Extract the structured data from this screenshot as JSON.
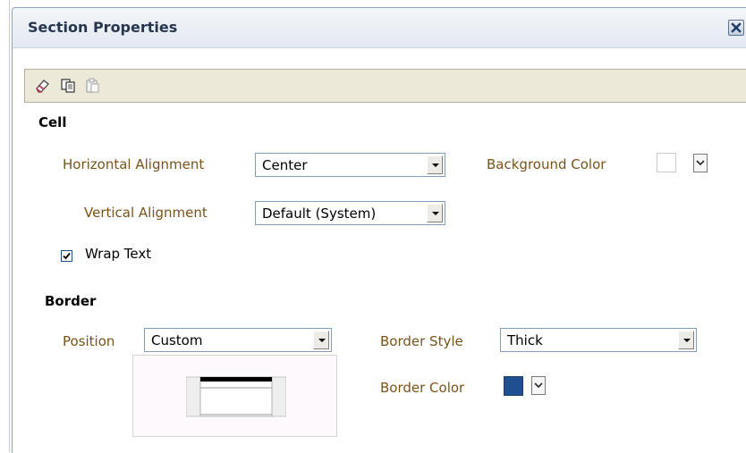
{
  "dialog": {
    "title": "Section Properties",
    "close_icon": "close-icon"
  },
  "toolbar": {
    "icons": [
      "eraser-icon",
      "copy-icon",
      "paste-icon"
    ]
  },
  "cell": {
    "heading": "Cell",
    "horizontal_alignment": {
      "label": "Horizontal Alignment",
      "value": "Center"
    },
    "vertical_alignment": {
      "label": "Vertical Alignment",
      "value": "Default (System)"
    },
    "background_color": {
      "label": "Background Color",
      "color": "#ffffff"
    },
    "wrap_text": {
      "label": "Wrap Text",
      "checked": true
    }
  },
  "border": {
    "heading": "Border",
    "position": {
      "label": "Position",
      "value": "Custom"
    },
    "border_style": {
      "label": "Border Style",
      "value": "Thick"
    },
    "border_color": {
      "label": "Border Color",
      "color": "#1f4f8f"
    }
  },
  "colors": {
    "label_text": "#7a5218",
    "title_text": "#26364e",
    "toolbar_bg": "#ece9d8"
  }
}
